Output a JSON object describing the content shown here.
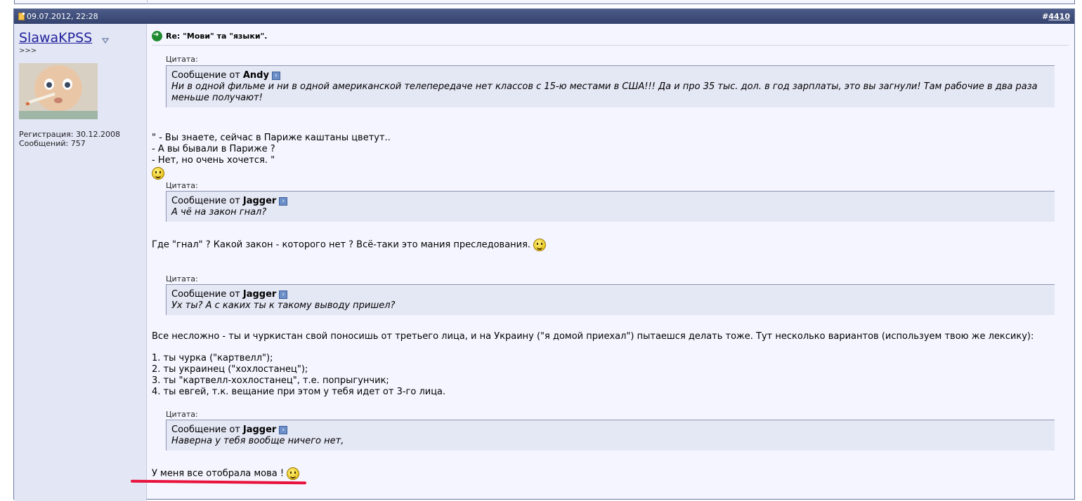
{
  "post": {
    "date": "09.07.2012, 22:28",
    "number": "4410",
    "number_prefix": "#"
  },
  "user": {
    "name": "SlawaKPSS",
    "title": ">>>",
    "registration": "Регистрация: 30.12.2008",
    "messages": "Сообщений: 757"
  },
  "title": "Re: \"Мови\" та \"языки\".",
  "quote_label": "Цитата:",
  "quote_from": "Сообщение от",
  "quotes": [
    {
      "author": "Andy",
      "lines": [
        "Ни в одной фильме и ни в одной американской телепередаче нет классов с 15-ю местами в США!!! Да и про 35 тыс. дол. в год зарплаты, это вы загнули! Там рабочие в два раза",
        "меньше получают!"
      ]
    },
    {
      "author": "Jagger",
      "lines": [
        "А чё на закон гнал?"
      ]
    },
    {
      "author": "Jagger",
      "lines": [
        "Ух ты? А с каких ты к такому выводу пришел?"
      ]
    },
    {
      "author": "Jagger",
      "lines": [
        "Наверна у тебя вообще ничего нет,"
      ]
    }
  ],
  "paragraphs": {
    "p1": [
      "\" - Вы знаете, сейчас в Париже каштаны цветут..",
      "- А вы бывали в Париже ?",
      "- Нет, но очень хочется. \""
    ],
    "p2": "Где \"гнал\" ? Какой закон - которого нет ? Всё-таки это мания преследования.",
    "p3": "Все несложно - ты и чуркистан свой поносишь от третьего лица, и на Украину (\"я домой приехал\") пытаешся делать тоже. Тут несколько вариантов (используем твою же лексику):",
    "list": [
      "1. ты чурка (\"картвелл\");",
      "2. ты украинец (\"хохлостанец\");",
      "3. ты \"картвелл-хохлостанец\", т.е. попрыгунчик;",
      "4. ты евгей, т.к. вещание при этом у тебя идет от 3-го лица."
    ],
    "p4": "У меня все отобрала мова !"
  },
  "colors": {
    "header": "#3f4d7b",
    "username": "#22229c",
    "underline": "#e8133c"
  }
}
